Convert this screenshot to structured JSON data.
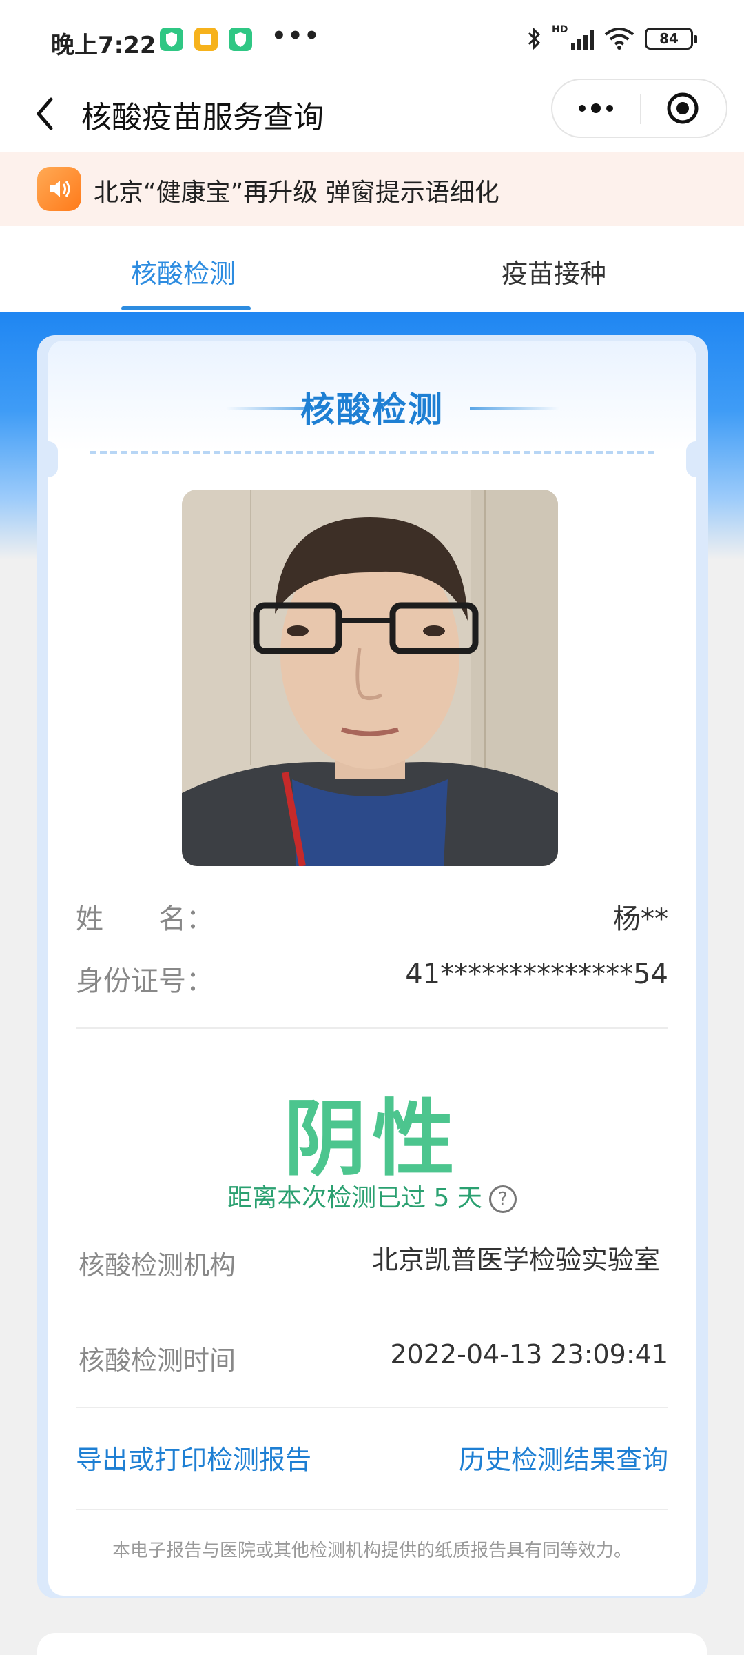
{
  "status_bar": {
    "time": "晚上7:22",
    "app_icons": [
      "shield-app-icon",
      "notes-app-icon",
      "shield-app-icon"
    ],
    "more_dots": "•••",
    "battery": "84",
    "signal_label": "HD"
  },
  "nav": {
    "title": "核酸疫苗服务查询"
  },
  "notice": {
    "text": "北京“健康宝”再升级 弹窗提示语细化"
  },
  "tabs": [
    {
      "label": "核酸检测",
      "active": true
    },
    {
      "label": "疫苗接种",
      "active": false
    }
  ],
  "card": {
    "title": "核酸检测",
    "name_label": "姓　　名：",
    "name_value": "杨**",
    "id_label": "身份证号：",
    "id_value": "41**************54",
    "result": "阴性",
    "elapsed_text": "距离本次检测已过 5 天",
    "help_symbol": "?",
    "org_label": "核酸检测机构",
    "org_value": "北京凯普医学检验实验室",
    "time_label": "核酸检测时间",
    "time_value": "2022-04-13 23:09:41",
    "export_link": "导出或打印检测报告",
    "history_link": "历史检测结果查询",
    "footnote": "本电子报告与医院或其他检测机构提供的纸质报告具有同等效力。"
  },
  "colors": {
    "accent": "#2d8ce0",
    "negative_green": "#4cc58e",
    "notice_bg": "#fdf1ec"
  }
}
